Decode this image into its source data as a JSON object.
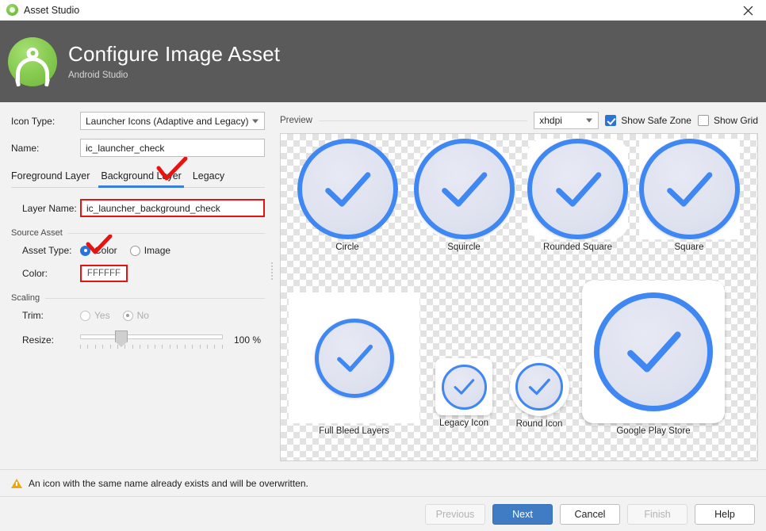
{
  "window": {
    "title": "Asset Studio",
    "app_icon": "android-studio-icon",
    "close_label": "close-icon"
  },
  "banner": {
    "title": "Configure Image Asset",
    "subtitle": "Android Studio",
    "logo": "android-studio-logo"
  },
  "form": {
    "icon_type_label": "Icon Type:",
    "icon_type_value": "Launcher Icons (Adaptive and Legacy)",
    "name_label": "Name:",
    "name_value": "ic_launcher_check",
    "tabs": [
      {
        "label": "Foreground Layer",
        "active": false
      },
      {
        "label": "Background Layer",
        "active": true
      },
      {
        "label": "Legacy",
        "active": false
      }
    ],
    "layer_name_label": "Layer Name:",
    "layer_name_value": "ic_launcher_background_check",
    "source_asset_group": "Source Asset",
    "asset_type_label": "Asset Type:",
    "asset_type_options": [
      {
        "label": "Color",
        "selected": true
      },
      {
        "label": "Image",
        "selected": false
      }
    ],
    "color_label": "Color:",
    "color_value": "FFFFFF",
    "scaling_group": "Scaling",
    "trim_label": "Trim:",
    "trim_options": [
      {
        "label": "Yes",
        "selected": false
      },
      {
        "label": "No",
        "selected": true
      }
    ],
    "resize_label": "Resize:",
    "resize_value": "100 %"
  },
  "preview": {
    "title": "Preview",
    "density_value": "xhdpi",
    "show_safe_zone_label": "Show Safe Zone",
    "show_safe_zone_checked": true,
    "show_grid_label": "Show Grid",
    "show_grid_checked": false,
    "tiles": [
      {
        "caption": "Circle"
      },
      {
        "caption": "Squircle"
      },
      {
        "caption": "Rounded Square"
      },
      {
        "caption": "Square"
      },
      {
        "caption": "Full Bleed Layers"
      },
      {
        "caption": "Legacy Icon"
      },
      {
        "caption": "Round Icon"
      },
      {
        "caption": "Google Play Store"
      }
    ]
  },
  "footer": {
    "warning": "An icon with the same name already exists and will be overwritten.",
    "warning_icon": "warning-triangle-icon",
    "buttons": [
      {
        "label": "Previous",
        "state": "disabled"
      },
      {
        "label": "Next",
        "state": "primary"
      },
      {
        "label": "Cancel",
        "state": "normal"
      },
      {
        "label": "Finish",
        "state": "disabled"
      },
      {
        "label": "Help",
        "state": "normal"
      }
    ]
  },
  "colors": {
    "banner_bg": "#5a5a5a",
    "accent_blue": "#3f87f2",
    "tab_underline": "#3b7ddd",
    "annotation_red": "#e8120f",
    "icon_fill": "#dfe2ef",
    "primary_button": "#3f7cc4"
  }
}
